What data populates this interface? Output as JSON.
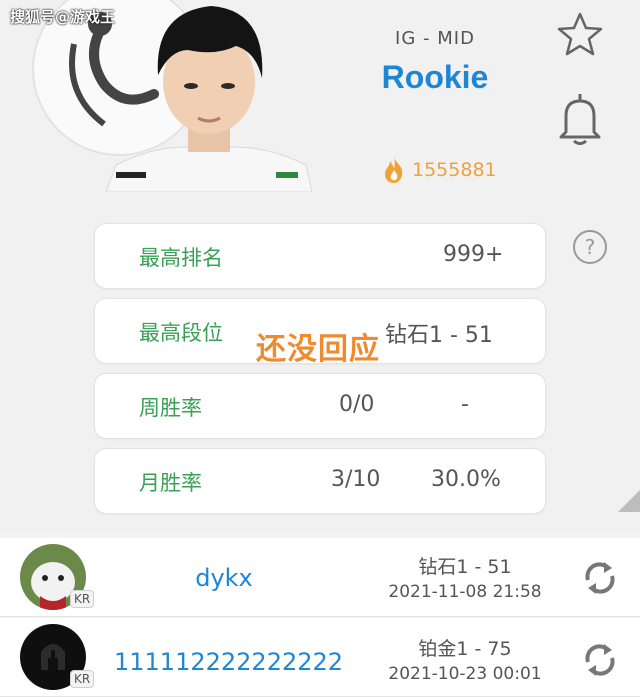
{
  "watermark": "搜狐号@游戏王",
  "player": {
    "subtitle": "IG - MID",
    "name": "Rookie",
    "hot_value": "1555881"
  },
  "header_icons": [
    "star-icon",
    "bell-icon",
    "help-icon"
  ],
  "help_label": "?",
  "stats": [
    {
      "label": "最高排名",
      "value1": "",
      "value2": "999+"
    },
    {
      "label": "最高段位",
      "value1": "",
      "value2": "钻石1 - 51"
    },
    {
      "label": "周胜率",
      "value1": "0/0",
      "value2": "-"
    },
    {
      "label": "月胜率",
      "value1": "3/10",
      "value2": "30.0%"
    }
  ],
  "overlay_caption": "还没回应",
  "accounts": [
    {
      "region": "KR",
      "summoner": "dykx",
      "rank": "钻石1 - 51",
      "date": "2021-11-08 21:58"
    },
    {
      "region": "KR",
      "summoner": "111112222222222",
      "rank": "铂金1 - 75",
      "date": "2021-10-23 00:01"
    }
  ],
  "colors": {
    "accent": "#1f86d6",
    "label_green": "#3aa055",
    "fire": "#f0a23a",
    "caption": "#f08a2c"
  }
}
